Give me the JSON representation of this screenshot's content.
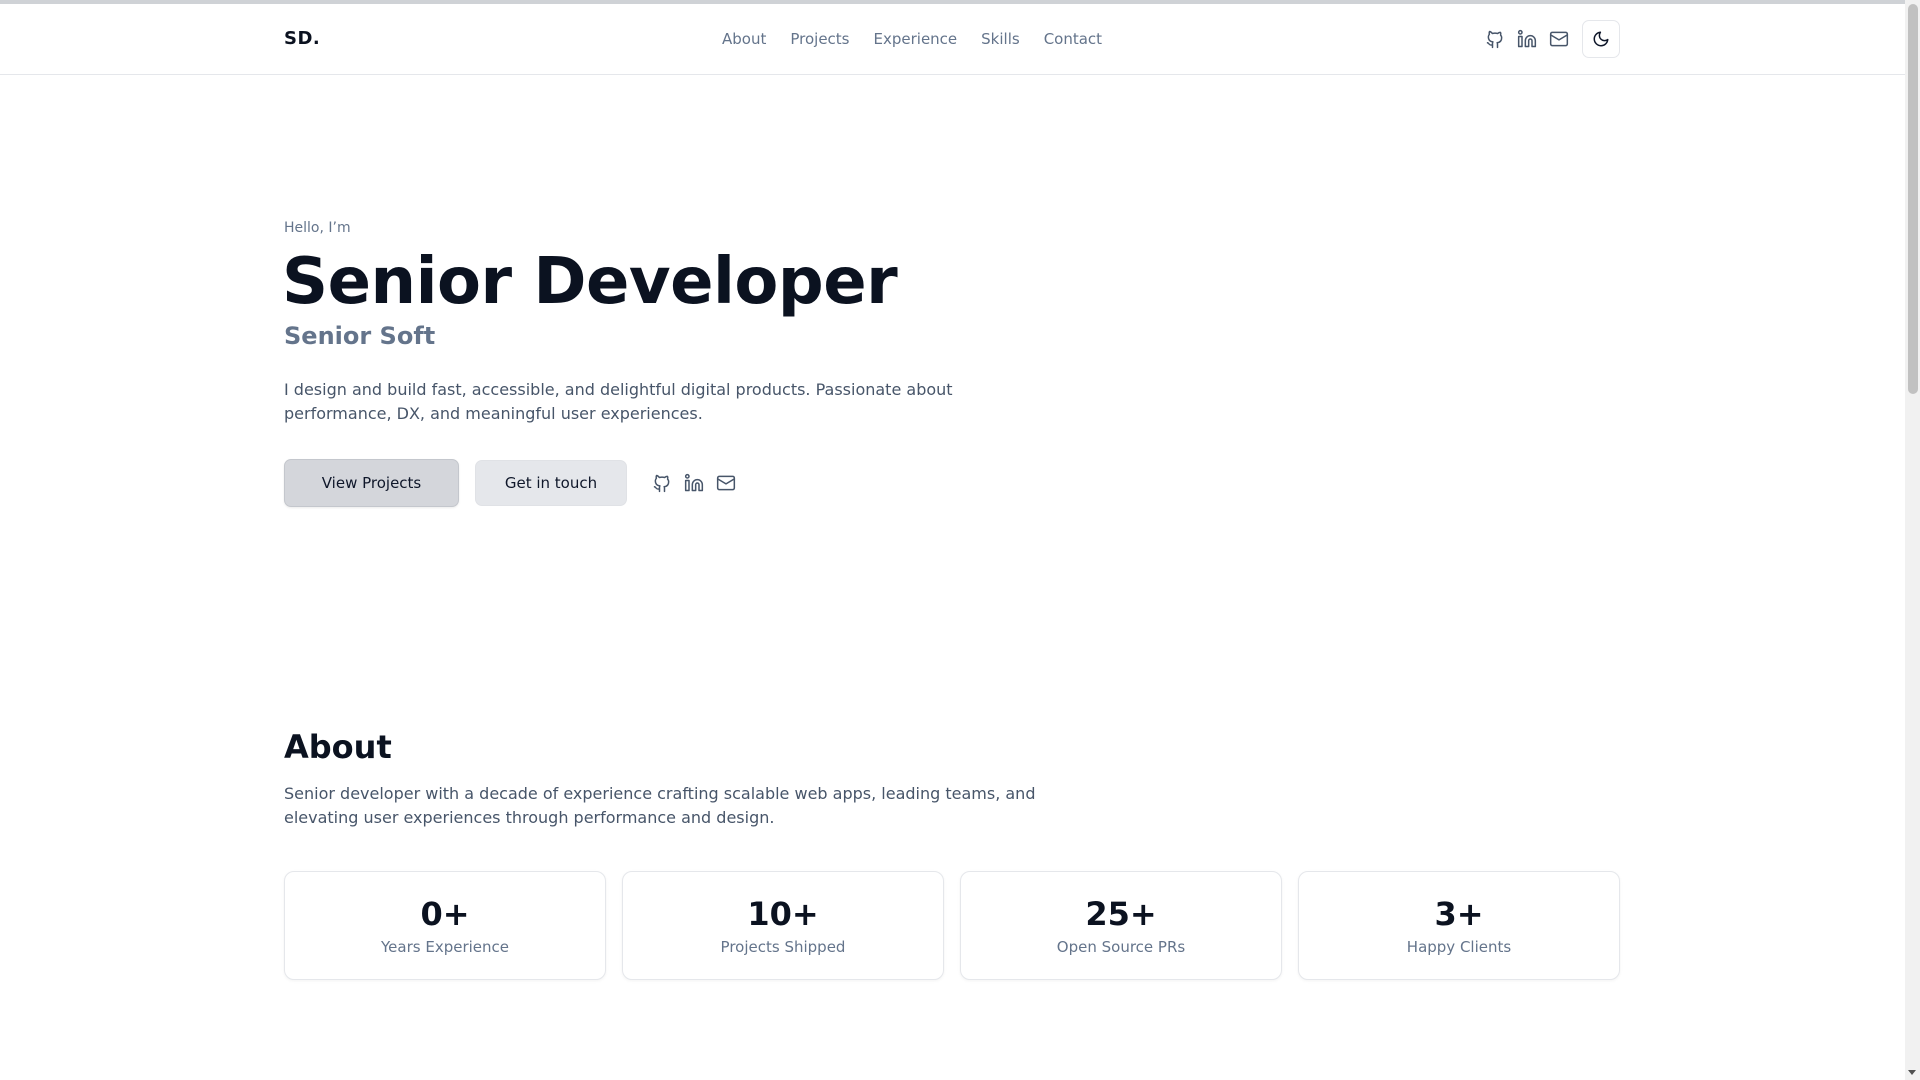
{
  "header": {
    "logo": "SD.",
    "nav": [
      "About",
      "Projects",
      "Experience",
      "Skills",
      "Contact"
    ],
    "icons": [
      "github-icon",
      "linkedin-icon",
      "mail-icon"
    ],
    "theme_toggle_icon": "moon-icon"
  },
  "hero": {
    "greeting": "Hello, I’m",
    "title": "Senior Developer",
    "subtitle": "Senior Soft",
    "description": "I design and build fast, accessible, and delightful digital products. Passionate about performance, DX, and meaningful user experiences.",
    "primary_button": "View Projects",
    "secondary_button": "Get in touch",
    "icons": [
      "github-icon",
      "linkedin-icon",
      "mail-icon"
    ]
  },
  "about": {
    "title": "About",
    "description": "Senior developer with a decade of experience crafting scalable web apps, leading teams, and elevating user experiences through performance and design.",
    "stats": [
      {
        "value": "0+",
        "label": "Years Experience"
      },
      {
        "value": "10+",
        "label": "Projects Shipped"
      },
      {
        "value": "25+",
        "label": "Open Source PRs"
      },
      {
        "value": "3+",
        "label": "Happy Clients"
      }
    ]
  },
  "colors": {
    "text_primary": "#0b1220",
    "text_muted": "#64748b",
    "border": "#e5e7eb",
    "primary_button_bg": "#d4d6db",
    "secondary_button_bg": "#e5e7eb"
  }
}
